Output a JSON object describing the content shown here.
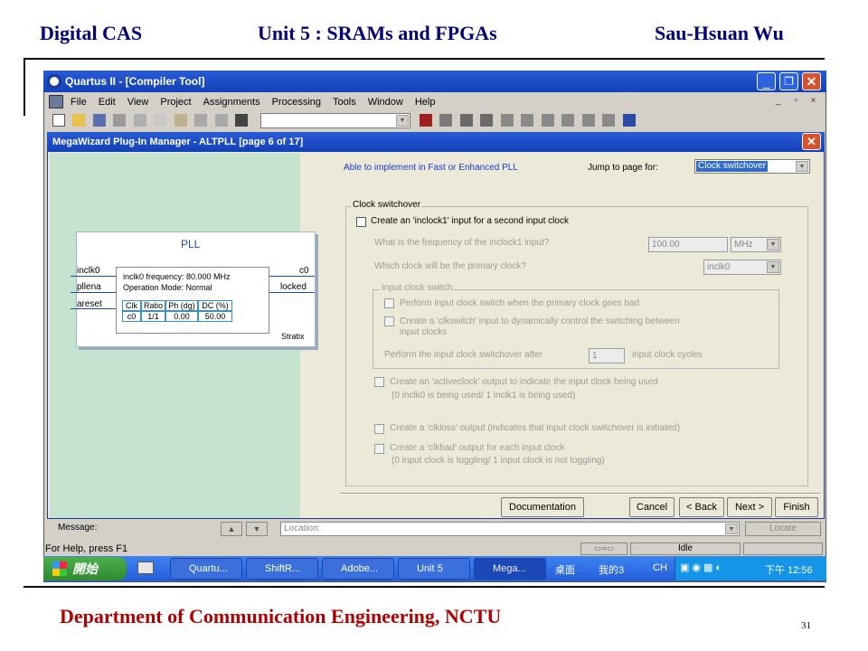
{
  "slide": {
    "header_left": "Digital CAS",
    "header_center": "Unit 5 : SRAMs and FPGAs",
    "header_right": "Sau-Hsuan Wu",
    "footer": "Department of Communication Engineering, NCTU",
    "page_number": "31"
  },
  "quartus": {
    "title": "Quartus II - [Compiler Tool]",
    "menu": [
      "File",
      "Edit",
      "View",
      "Project",
      "Assignments",
      "Processing",
      "Tools",
      "Window",
      "Help"
    ],
    "message_label": "Message:",
    "location_label": "Location:",
    "locate_button": "Locate",
    "status_help": "For Help, press F1",
    "status_idle": "Idle"
  },
  "wizard": {
    "title": "MegaWizard Plug-In Manager - ALTPLL [page 6 of 17]",
    "able_text": "Able to implement in Fast or Enhanced PLL",
    "jump_label": "Jump to page for:",
    "jump_value": "Clock switchover",
    "group_title": "Clock switchover",
    "create_inclock1": "Create an 'inclock1' input for a second input clock",
    "freq_question": "What is the frequency of the inclock1 input?",
    "freq_value": "100.00",
    "freq_unit": "MHz",
    "primary_question": "Which clock will be the primary clock?",
    "primary_value": "inclk0",
    "subgroup_title": "Input clock switch",
    "perform_switch": "Perform input clock switch when the primary clock goes bad",
    "clkswitch_line1": "Create a 'clkswitch' input to dynamically control the switching between",
    "clkswitch_line2": "input clocks",
    "perform_after": "Perform the input clock switchover after",
    "cycles_value": "1",
    "cycles_label": "input clock cycles",
    "activeclock_line1": "Create an 'activeclock' output to indicate the input clock being used",
    "activeclock_line2": "(0 inclk0 is being used/ 1 inclk1 is being used)",
    "clkloss": "Create a 'clkloss' output (indicates that input clock switchover is initiated)",
    "clkbad_line1": "Create a 'clkbad' output  for each input clock",
    "clkbad_line2": "(0 input clock is toggling/ 1 input clock is not toggling)",
    "buttons": {
      "documentation": "Documentation",
      "cancel": "Cancel",
      "back": "< Back",
      "next": "Next >",
      "finish": "Finish"
    }
  },
  "pll_block": {
    "title": "PLL",
    "inputs": [
      "inclk0",
      "pllena",
      "areset"
    ],
    "outputs": [
      "c0",
      "locked"
    ],
    "info_line1": "inclk0 frequency: 80.000 MHz",
    "info_line2": "Operation Mode: Normal",
    "table_headers": [
      "Clk",
      "Ratio",
      "Ph (dg)",
      "DC (%)"
    ],
    "table_row": [
      "c0",
      "1/1",
      "0.00",
      "50.00"
    ],
    "family": "Stratix"
  },
  "taskbar": {
    "start": "開始",
    "tasks": [
      "Quartu...",
      "ShiftR...",
      "Adobe...",
      "Unit 5",
      "Mega..."
    ],
    "desktop": "桌面",
    "mydoc": "我的3",
    "lang": "CH",
    "clock": "下午 12:56"
  },
  "colors": {
    "accent": "#00007a",
    "footer": "#b00000",
    "xp_blue": "#1240b8",
    "preview_bg": "#c5e3cf"
  }
}
